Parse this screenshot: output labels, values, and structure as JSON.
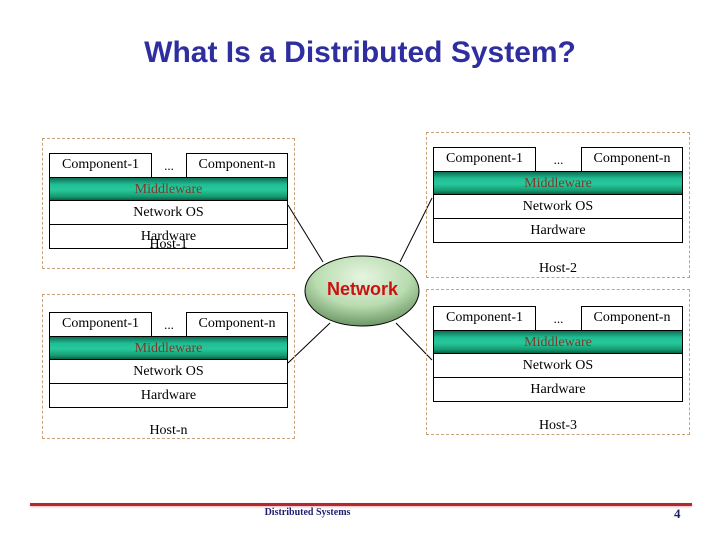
{
  "slide": {
    "title": "What Is a Distributed System?",
    "footer": "Distributed Systems",
    "page_number": "4"
  },
  "colors": {
    "title": "#2e2ea0",
    "middleware": "#1fbf94",
    "network_label": "#cc1111",
    "footer_rule": "#b5262e",
    "host_border": "#c9a27a"
  },
  "network": {
    "label": "Network"
  },
  "hosts": [
    {
      "name": "Host-1",
      "component_first": "Component-1",
      "ellipsis": "...",
      "component_last": "Component-n",
      "middleware": "Middleware",
      "network_os": "Network OS",
      "hardware": "Hardware"
    },
    {
      "name": "Host-2",
      "component_first": "Component-1",
      "ellipsis": "...",
      "component_last": "Component-n",
      "middleware": "Middleware",
      "network_os": "Network OS",
      "hardware": "Hardware"
    },
    {
      "name": "Host-n",
      "component_first": "Component-1",
      "ellipsis": "...",
      "component_last": "Component-n",
      "middleware": "Middleware",
      "network_os": "Network OS",
      "hardware": "Hardware"
    },
    {
      "name": "Host-3",
      "component_first": "Component-1",
      "ellipsis": "...",
      "component_last": "Component-n",
      "middleware": "Middleware",
      "network_os": "Network OS",
      "hardware": "Hardware"
    }
  ]
}
